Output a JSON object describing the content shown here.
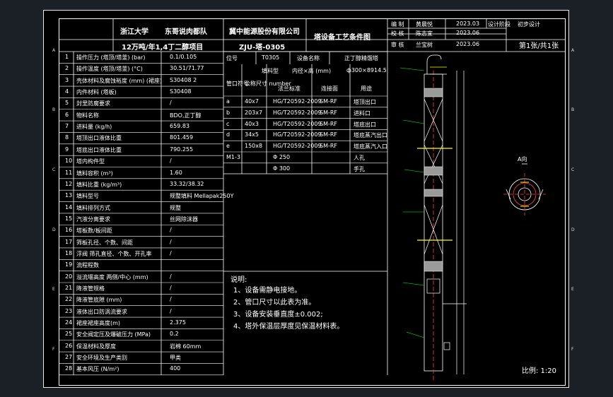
{
  "header": {
    "university": "浙江大学",
    "team": "东哥说肉都队",
    "company": "冀中能源股份有限公司",
    "project": "12万吨/年1,4丁二醇项目",
    "drawing_no": "ZJU-塔-0305",
    "title": "塔设备工艺条件图",
    "sign_rows": [
      {
        "role": "编 制",
        "name": "黄晨悦",
        "date": "2023.03"
      },
      {
        "role": "校 核",
        "name": "陈志宜",
        "date": "2023.06"
      },
      {
        "role": "审 核",
        "name": "兰宝树",
        "date": "2023.06"
      }
    ],
    "stage_label": "设计阶段",
    "stage_value": "初步设计",
    "sheet_info": "第1张/共1张"
  },
  "params": [
    {
      "no": "1",
      "name": "操作压力 (塔顶/塔釜) (bar)",
      "value": "0.1/0.105"
    },
    {
      "no": "2",
      "name": "操作温度 (塔顶/塔釜) (°C)",
      "value": "30.51/71.77"
    },
    {
      "no": "3",
      "name": "壳体材料及腐蚀裕度 (mm) (裙座)",
      "value": "S30408 2"
    },
    {
      "no": "4",
      "name": "内件材料 (塔板)",
      "value": "S30408"
    },
    {
      "no": "5",
      "name": "封里防腐要求",
      "value": "/"
    },
    {
      "no": "6",
      "name": "物料名称",
      "value": "BDO,正丁醇"
    },
    {
      "no": "7",
      "name": "进料量 (kg/h)",
      "value": "659.83"
    },
    {
      "no": "8",
      "name": "塔顶出口液体比重",
      "value": "801.459"
    },
    {
      "no": "9",
      "name": "塔底出口液体比重",
      "value": "790.255"
    },
    {
      "no": "10",
      "name": "塔内构件型",
      "value": "/"
    },
    {
      "no": "11",
      "name": "填料容积 (m³)",
      "value": "1.60"
    },
    {
      "no": "12",
      "name": "填料比重 (kg/m³)",
      "value": "33.32/38.32"
    },
    {
      "no": "13",
      "name": "填料型号",
      "value": "规整填料 Mellapak250Y"
    },
    {
      "no": "14",
      "name": "填料排列方式",
      "value": "规整"
    },
    {
      "no": "15",
      "name": "汽液分离要求",
      "value": "丝网除沫器"
    },
    {
      "no": "16",
      "name": "塔板数/板间距",
      "value": "/"
    },
    {
      "no": "17",
      "name": "筛板孔径、个数、间距",
      "value": "/"
    },
    {
      "no": "18",
      "name": "浮阀 筛孔直径、个数、开孔率",
      "value": "/"
    },
    {
      "no": "19",
      "name": "流程程数",
      "value": ""
    },
    {
      "no": "20",
      "name": "溢流堰高度 两侧/中心 (mm)",
      "value": "/"
    },
    {
      "no": "21",
      "name": "降液管规格",
      "value": "/"
    },
    {
      "no": "22",
      "name": "降液管底隙 (mm)",
      "value": "/"
    },
    {
      "no": "23",
      "name": "液体出口防涡流要求",
      "value": "/"
    },
    {
      "no": "24",
      "name": "裙座裙座高度(m)",
      "value": "2.375"
    },
    {
      "no": "25",
      "name": "安全阀定压及爆破压力 (MPa)",
      "value": "0.2"
    },
    {
      "no": "26",
      "name": "保温材料及厚度",
      "value": "岩棉 60mm"
    },
    {
      "no": "27",
      "name": "安全环境及生产类别",
      "value": "甲类"
    },
    {
      "no": "28",
      "name": "基本风压 (N/m²)",
      "value": "400"
    }
  ],
  "equip": {
    "no_label": "位号",
    "no_value": "T0305",
    "name_label": "设备名称",
    "name_value": "正丁醇精馏塔",
    "packing_label": "填料型",
    "inner_label": "内径×高 (mm)",
    "inner_value": "ф300×8914.5"
  },
  "nozzle_headers": {
    "symbol": "管口符号",
    "spec": "公称尺寸 number",
    "std": "法兰标准",
    "face": "连接面",
    "use": "用途"
  },
  "nozzles": [
    {
      "sym": "a",
      "size": "40x7",
      "std": "HG/T20592-2009",
      "face": "SM-RF",
      "use": "塔顶出口"
    },
    {
      "sym": "b",
      "size": "203x7",
      "std": "HG/T20592-2009",
      "face": "SM-RF",
      "use": "进料口"
    },
    {
      "sym": "c",
      "size": "40x3",
      "std": "HG/T20592-2009",
      "face": "SM-RF",
      "use": "塔底出口"
    },
    {
      "sym": "d",
      "size": "34x5",
      "std": "HG/T20592-2009",
      "face": "SM-RF",
      "use": "塔底蒸汽出口"
    },
    {
      "sym": "e",
      "size": "150x8",
      "std": "HG/T20592-2009",
      "face": "SM-RF",
      "use": "塔底蒸汽入口"
    },
    {
      "sym": "M1-3",
      "size": "",
      "std": "Φ 250",
      "face": "",
      "use": "人孔"
    },
    {
      "sym": "",
      "size": "",
      "std": "Φ 300",
      "face": "",
      "use": "手孔"
    }
  ],
  "notes": {
    "title": "说明:",
    "lines": [
      "1、设备需静电接地。",
      "2、管口尺寸以此表为准。",
      "3、设备安装垂直度±0.002;",
      "4、塔外保温层厚度见保温材料表。"
    ]
  },
  "scale": "比例: 1:20",
  "view_label": "A向",
  "zones": [
    "A",
    "B",
    "C",
    "D",
    "E",
    "F"
  ]
}
